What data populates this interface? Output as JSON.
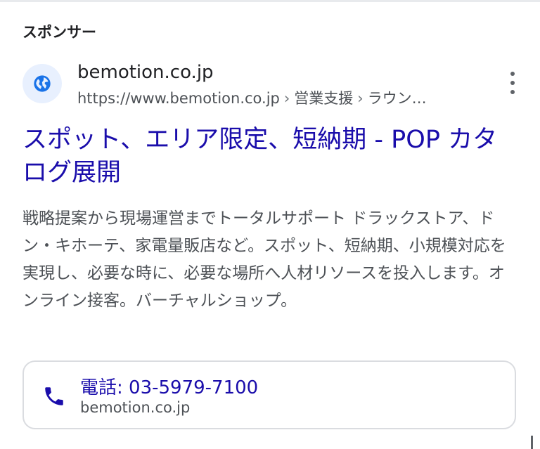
{
  "ad": {
    "sponsored_label": "スポンサー",
    "site_name": "bemotion.co.jp",
    "url_parts": [
      "https://www.bemotion.co.jp",
      "営業支援",
      "ラウン…"
    ],
    "url_separator": "›",
    "title": "スポット、エリア限定、短納期 - POP カタログ展開",
    "description": "戦略提案から現場運営までトータルサポート ドラックストア、ドン・キホーテ、家電量販店など。スポット、短納期、小規模対応を実現し、必要な時に、必要な場所へ人材リソースを投入します。オンライン接客。バーチャルショップ。",
    "favicon_icon": "globe-icon",
    "menu_icon": "more-vert-icon"
  },
  "call_extension": {
    "label": "電話: 03-5979-7100",
    "domain": "bemotion.co.jp",
    "icon": "phone-icon"
  },
  "colors": {
    "link_blue": "#1a0dab",
    "text_dark": "#202124",
    "text_gray": "#4d5156",
    "favicon_bg": "#e8f0fe",
    "favicon_fg": "#1a73e8",
    "card_border": "#dadce0"
  }
}
